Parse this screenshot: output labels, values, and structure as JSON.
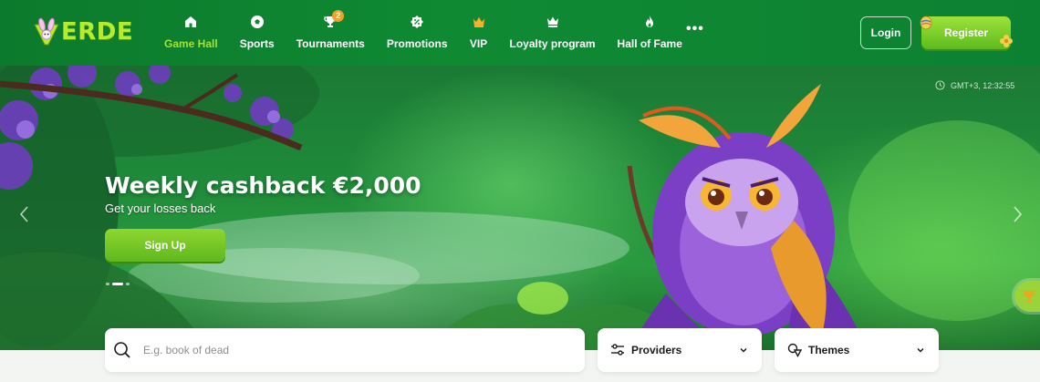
{
  "brand": {
    "logo_text": "ERDE"
  },
  "nav": {
    "items": [
      {
        "label": "Game Hall",
        "icon": "home-icon",
        "active": true
      },
      {
        "label": "Sports",
        "icon": "soccer-ball-icon"
      },
      {
        "label": "Tournaments",
        "icon": "trophy-icon",
        "badge": "2"
      },
      {
        "label": "Promotions",
        "icon": "percent-icon"
      },
      {
        "label": "VIP",
        "icon": "crown-icon"
      },
      {
        "label": "Loyalty program",
        "icon": "crown-outline-icon"
      },
      {
        "label": "Hall of Fame",
        "icon": "flame-icon"
      }
    ],
    "more": "•••"
  },
  "auth": {
    "login_label": "Login",
    "register_label": "Register"
  },
  "hero": {
    "title": "Weekly cashback €2,000",
    "subtitle": "Get your losses back",
    "cta_label": "Sign Up",
    "clock_text": "GMT+3, 12:32:55",
    "slide_count": 3,
    "active_slide": 2
  },
  "filters": {
    "search_placeholder": "E.g. book of dead",
    "providers_label": "Providers",
    "themes_label": "Themes"
  },
  "colors": {
    "header_green": "#0f8a33",
    "accent_lime": "#a6e22e",
    "button_green": "#6cc424"
  }
}
